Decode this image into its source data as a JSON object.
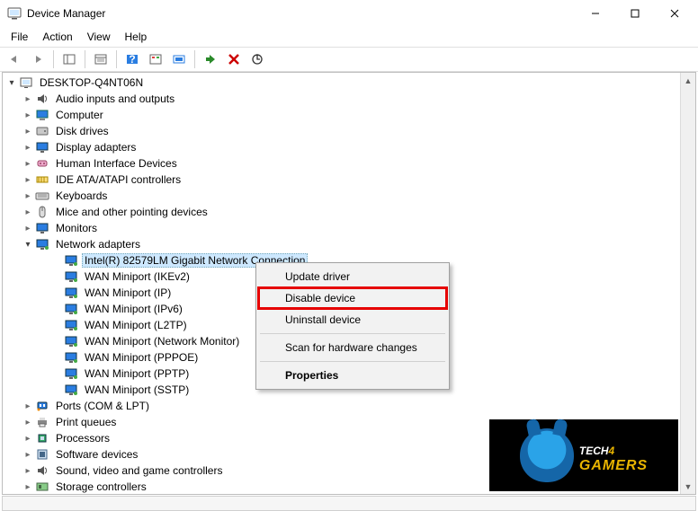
{
  "window": {
    "title": "Device Manager"
  },
  "menubar": {
    "file": "File",
    "action": "Action",
    "view": "View",
    "help": "Help"
  },
  "tree": {
    "root": "DESKTOP-Q4NT06N",
    "nodes": [
      {
        "label": "Audio inputs and outputs",
        "icon": "audio"
      },
      {
        "label": "Computer",
        "icon": "computer"
      },
      {
        "label": "Disk drives",
        "icon": "disk"
      },
      {
        "label": "Display adapters",
        "icon": "display"
      },
      {
        "label": "Human Interface Devices",
        "icon": "hid"
      },
      {
        "label": "IDE ATA/ATAPI controllers",
        "icon": "ide"
      },
      {
        "label": "Keyboards",
        "icon": "keyboard"
      },
      {
        "label": "Mice and other pointing devices",
        "icon": "mouse"
      },
      {
        "label": "Monitors",
        "icon": "monitor"
      },
      {
        "label": "Network adapters",
        "icon": "network",
        "expanded": true
      },
      {
        "label": "Ports (COM & LPT)",
        "icon": "port"
      },
      {
        "label": "Print queues",
        "icon": "printer"
      },
      {
        "label": "Processors",
        "icon": "cpu"
      },
      {
        "label": "Software devices",
        "icon": "software"
      },
      {
        "label": "Sound, video and game controllers",
        "icon": "sound"
      },
      {
        "label": "Storage controllers",
        "icon": "storage"
      }
    ],
    "network_children": [
      {
        "label": "Intel(R) 82579LM Gigabit Network Connection",
        "selected": true
      },
      {
        "label": "WAN Miniport (IKEv2)"
      },
      {
        "label": "WAN Miniport (IP)"
      },
      {
        "label": "WAN Miniport (IPv6)"
      },
      {
        "label": "WAN Miniport (L2TP)"
      },
      {
        "label": "WAN Miniport (Network Monitor)"
      },
      {
        "label": "WAN Miniport (PPPOE)"
      },
      {
        "label": "WAN Miniport (PPTP)"
      },
      {
        "label": "WAN Miniport (SSTP)"
      }
    ]
  },
  "context_menu": {
    "update_driver": "Update driver",
    "disable_device": "Disable device",
    "uninstall_device": "Uninstall device",
    "scan_hw": "Scan for hardware changes",
    "properties": "Properties"
  },
  "watermark": {
    "line1_a": "TECH",
    "line1_b": "4",
    "line2": "GAMERS"
  }
}
